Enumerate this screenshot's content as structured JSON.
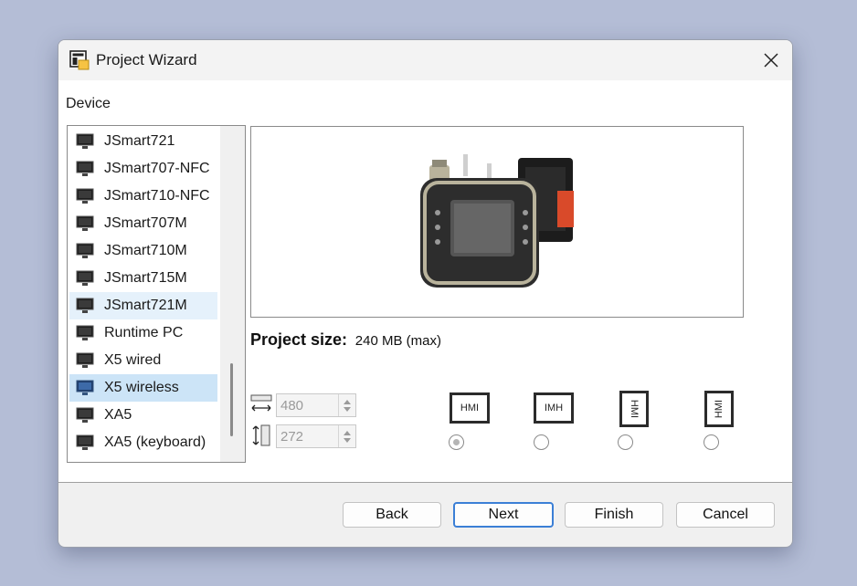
{
  "window": {
    "title": "Project Wizard"
  },
  "device_label": "Device",
  "devices": [
    {
      "label": "JSmart721"
    },
    {
      "label": "JSmart707-NFC"
    },
    {
      "label": "JSmart710-NFC"
    },
    {
      "label": "JSmart707M"
    },
    {
      "label": "JSmart710M"
    },
    {
      "label": "JSmart715M"
    },
    {
      "label": "JSmart721M"
    },
    {
      "label": "Runtime PC"
    },
    {
      "label": "X5 wired"
    },
    {
      "label": "X5 wireless"
    },
    {
      "label": "XA5"
    },
    {
      "label": "XA5 (keyboard)"
    }
  ],
  "selected_device": "X5 wireless",
  "project_size": {
    "label": "Project size:",
    "value": "240 MB (max)"
  },
  "width_value": "480",
  "height_value": "272",
  "orientations": [
    {
      "text": "HMI",
      "checked": true
    },
    {
      "text": "HMI",
      "checked": false
    },
    {
      "text": "HMI",
      "checked": false
    },
    {
      "text": "HMI",
      "checked": false
    }
  ],
  "buttons": {
    "back": "Back",
    "next": "Next",
    "finish": "Finish",
    "cancel": "Cancel"
  },
  "colors": {
    "selection": "#cce4f7",
    "hover": "#e5f1fb",
    "default_button_border": "#3b7fd6"
  }
}
